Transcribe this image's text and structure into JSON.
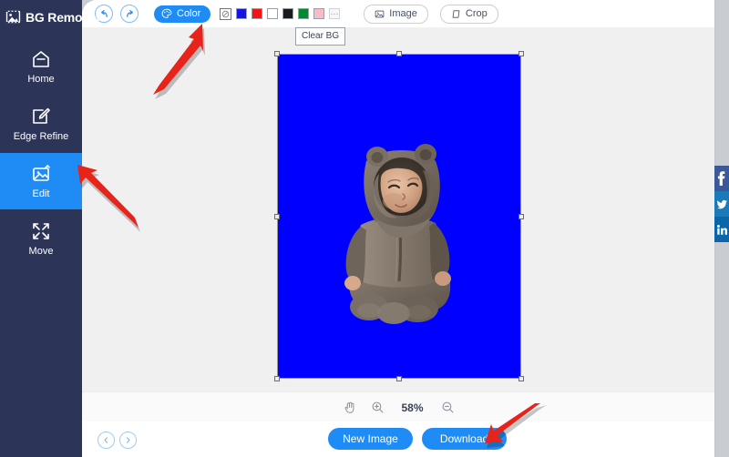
{
  "app": {
    "brand": "BG Remover",
    "logo_icon": "image-mountain-icon"
  },
  "sidebar": {
    "items": [
      {
        "label": "Home",
        "icon": "home-icon",
        "active": false
      },
      {
        "label": "Edge Refine",
        "icon": "edge-refine-icon",
        "active": false
      },
      {
        "label": "Edit",
        "icon": "edit-image-icon",
        "active": true
      },
      {
        "label": "Move",
        "icon": "move-icon",
        "active": false
      }
    ],
    "active_index": 2,
    "background_color": "#2c3558",
    "active_color": "#1f8cf5"
  },
  "toolbar": {
    "undo_label": "Undo",
    "undo_icon": "undo-arrow-icon",
    "redo_label": "Redo",
    "redo_icon": "redo-arrow-icon",
    "color_label": "Color",
    "color_icon": "palette-icon",
    "image_label": "Image",
    "image_icon": "image-icon",
    "crop_label": "Crop",
    "crop_icon": "crop-icon",
    "swatches": [
      {
        "name": "Clear BG",
        "color": "transparent",
        "icon": "no-fill-icon",
        "selected": true
      },
      {
        "name": "Blue",
        "color": "#1414e6",
        "selected": false
      },
      {
        "name": "Red",
        "color": "#f01414",
        "selected": false
      },
      {
        "name": "White",
        "color": "#ffffff",
        "selected": false
      },
      {
        "name": "Black",
        "color": "#1a1a1a",
        "selected": false
      },
      {
        "name": "Green",
        "color": "#00892e",
        "selected": false
      },
      {
        "name": "Pink",
        "color": "#f8bcc6",
        "selected": false
      },
      {
        "name": "More",
        "color": "#f6f7f9",
        "icon": "more-dots-icon",
        "selected": false
      }
    ]
  },
  "tooltip": {
    "text": "Clear BG"
  },
  "canvas": {
    "background_color": "#0000fe",
    "subject_description": "baby in grey bear onesie",
    "selected": true,
    "handle_count": 8
  },
  "zoombar": {
    "hand_tool_icon": "hand-icon",
    "zoom_in_icon": "zoom-in-icon",
    "zoom_out_icon": "zoom-out-icon",
    "zoom_level": "58%"
  },
  "bottombar": {
    "prev_label": "Previous",
    "prev_icon": "chevron-left-icon",
    "next_label": "Next",
    "next_icon": "chevron-right-icon",
    "new_image_label": "New Image",
    "download_label": "Download",
    "accent_color": "#1f8cf5"
  },
  "social": {
    "items": [
      {
        "name": "Facebook",
        "icon": "facebook-icon",
        "color": "#3b5998"
      },
      {
        "name": "Twitter",
        "icon": "twitter-icon",
        "color": "#1b7bb9"
      },
      {
        "name": "LinkedIn",
        "icon": "linkedin-icon",
        "color": "#0a66a8"
      }
    ]
  },
  "annotations": {
    "color": "#e8231a",
    "arrows": [
      {
        "name": "arrow-to-clear-bg-swatch",
        "points_to": "Clear BG swatch"
      },
      {
        "name": "arrow-to-edit-sidebar",
        "points_to": "Edit sidebar item"
      },
      {
        "name": "arrow-to-download-button",
        "points_to": "Download button"
      }
    ]
  }
}
